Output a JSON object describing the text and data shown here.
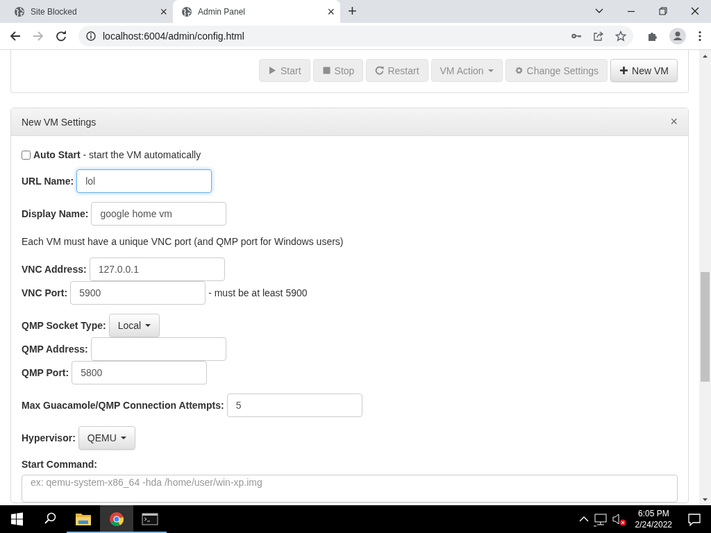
{
  "browser": {
    "tabs": [
      {
        "title": "Site Blocked",
        "close": "×",
        "selected": false
      },
      {
        "title": "Admin Panel",
        "close": "×",
        "selected": true
      }
    ],
    "new_tab": "+",
    "address": "localhost:6004/admin/config.html"
  },
  "toolbar": {
    "buttons": [
      {
        "kind": "start",
        "label": "Start",
        "disabled": true
      },
      {
        "kind": "stop",
        "label": "Stop",
        "disabled": true
      },
      {
        "kind": "restart",
        "label": "Restart",
        "disabled": true
      },
      {
        "kind": "dropdown",
        "label": "VM Action",
        "disabled": true
      },
      {
        "kind": "settings",
        "label": "Change Settings",
        "disabled": true
      },
      {
        "kind": "add",
        "label": "New VM",
        "disabled": false
      }
    ]
  },
  "panel": {
    "title": "New VM Settings",
    "close": "×",
    "auto_start": {
      "checked": false,
      "text": "**Auto Start** - start the VM automatically"
    },
    "groups": [
      {
        "rows": [
          {
            "kind": "text",
            "label": "URL Name:",
            "value": "lol",
            "focused": true
          }
        ]
      },
      {
        "rows": [
          {
            "kind": "text",
            "label": "Display Name:",
            "value": "google home vm",
            "focused": false
          }
        ]
      },
      {
        "rows": [
          {
            "kind": "note",
            "text": "Each VM must have a unique VNC port (and QMP port for Windows users)"
          }
        ]
      },
      {
        "rows": [
          {
            "kind": "text",
            "label": "VNC Address:",
            "value": "127.0.0.1",
            "focused": false
          },
          {
            "kind": "text",
            "label": "VNC Port:",
            "value": "5900",
            "hint": "- must be at least 5900",
            "focused": false
          }
        ]
      },
      {
        "rows": [
          {
            "kind": "dropdown",
            "label": "QMP Socket Type:",
            "value": "Local"
          },
          {
            "kind": "text",
            "label": "QMP Address:",
            "focused": false
          },
          {
            "kind": "text",
            "label": "QMP Port:",
            "value": "5800",
            "focused": false
          }
        ]
      },
      {
        "rows": [
          {
            "kind": "text",
            "label": "Max Guacamole/QMP Connection Attempts:",
            "value": "5",
            "focused": false
          }
        ]
      },
      {
        "rows": [
          {
            "kind": "dropdown",
            "label": "Hypervisor:",
            "value": "QEMU"
          }
        ]
      },
      {
        "rows": [
          {
            "kind": "textarea",
            "label": "Start Command:",
            "placeholder": "ex: qemu-system-x86_64 -hda /home/user/win-xp.img"
          }
        ]
      }
    ]
  },
  "taskbar": {
    "apps": [
      {
        "kind": "folder",
        "selected": false
      },
      {
        "kind": "browser",
        "selected": true
      },
      {
        "kind": "terminal",
        "selected": false
      }
    ],
    "time": "6:05 PM",
    "date": "2/24/2022"
  }
}
